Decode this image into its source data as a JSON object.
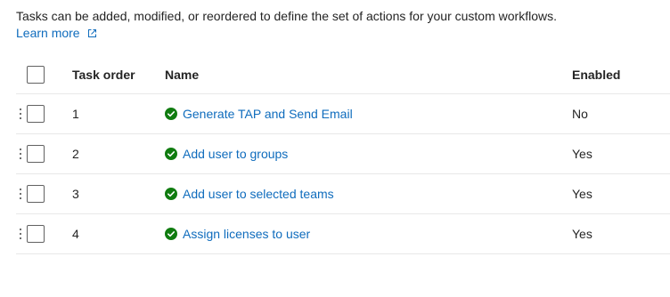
{
  "description": "Tasks can be added, modified, or reordered to define the set of actions for your custom workflows.",
  "learn_more": {
    "label": "Learn more",
    "icon": "external-link-icon"
  },
  "table": {
    "headers": {
      "task_order": "Task order",
      "name": "Name",
      "enabled": "Enabled"
    },
    "rows": [
      {
        "order": "1",
        "name": "Generate TAP and Send Email",
        "enabled": "No",
        "status": "success"
      },
      {
        "order": "2",
        "name": "Add user to groups",
        "enabled": "Yes",
        "status": "success"
      },
      {
        "order": "3",
        "name": "Add user to selected teams",
        "enabled": "Yes",
        "status": "success"
      },
      {
        "order": "4",
        "name": "Assign licenses to user",
        "enabled": "Yes",
        "status": "success"
      }
    ]
  },
  "colors": {
    "link": "#0f6cbd",
    "success": "#107c10"
  }
}
